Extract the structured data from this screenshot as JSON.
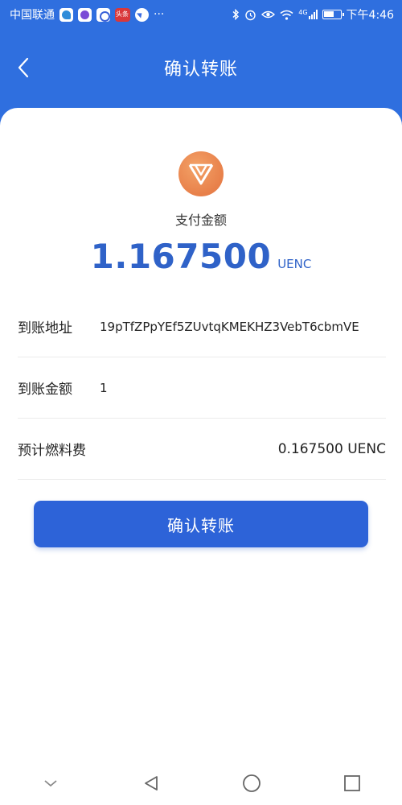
{
  "status_bar": {
    "carrier": "中国联通",
    "more": "···",
    "network": "4G",
    "time": "下午4:46"
  },
  "header": {
    "title": "确认转账"
  },
  "payment": {
    "label": "支付金额",
    "amount": "1.167500",
    "unit": "UENC"
  },
  "details": {
    "address_label": "到账地址",
    "address_value": "19pTfZPpYEf5ZUvtqKMEKHZ3VebT6cbmVE",
    "amount_label": "到账金额",
    "amount_value": "1",
    "fee_label": "预计燃料费",
    "fee_value": "0.167500 UENC"
  },
  "confirm_button": {
    "label": "确认转账"
  },
  "colors": {
    "primary": "#2f6fdf",
    "button": "#2d63d8",
    "amount": "#2f62c8",
    "logo": "#e8804a"
  }
}
